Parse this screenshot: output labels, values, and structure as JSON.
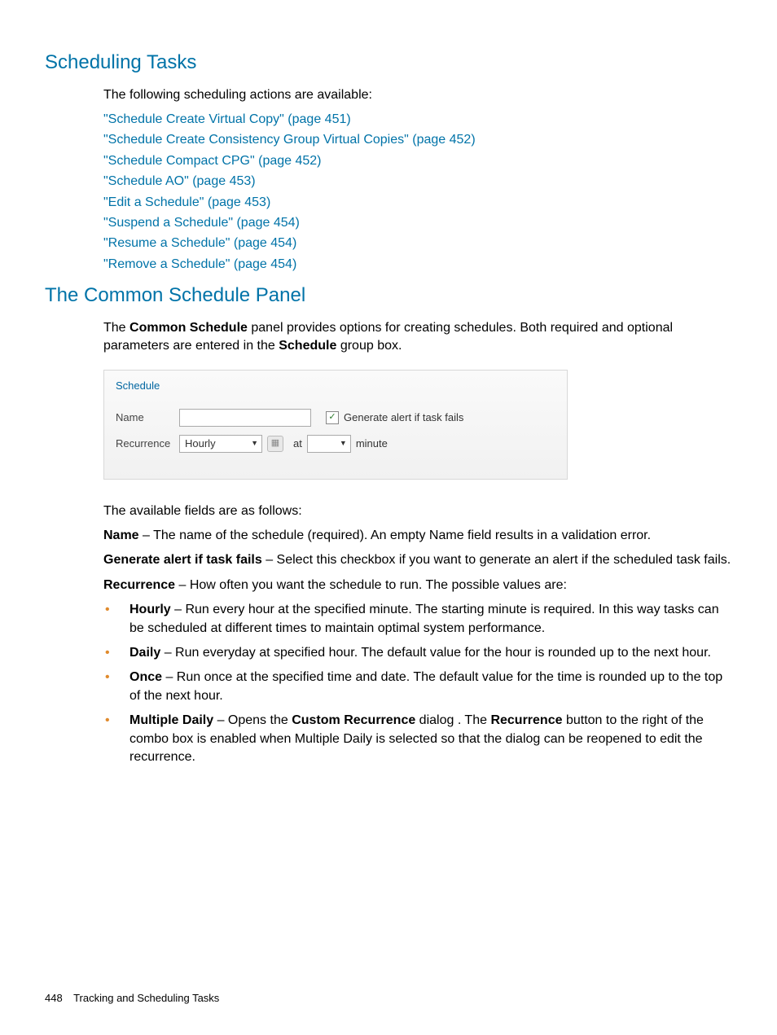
{
  "headings": {
    "h1": "Scheduling Tasks",
    "h2": "The Common Schedule Panel"
  },
  "intro1": "The following scheduling actions are available:",
  "links": [
    "\"Schedule Create Virtual Copy\" (page 451)",
    "\"Schedule Create Consistency Group Virtual Copies\" (page 452)",
    "\"Schedule Compact CPG\" (page 452)",
    "\"Schedule AO\" (page 453)",
    "\"Edit a Schedule\" (page 453)",
    "\"Suspend a Schedule\" (page 454)",
    "\"Resume a Schedule\" (page 454)",
    "\"Remove a Schedule\" (page 454)"
  ],
  "panel_intro": {
    "pre": "The ",
    "b1": "Common Schedule",
    "mid": " panel provides options for creating schedules. Both required and optional parameters are entered in the ",
    "b2": "Schedule",
    "post": " group box."
  },
  "panel": {
    "group_title": "Schedule",
    "name_label": "Name",
    "checkbox_label": "Generate alert if task fails",
    "recurrence_label": "Recurrence",
    "recurrence_value": "Hourly",
    "at_label": "at",
    "minute_label": "minute"
  },
  "fields_intro": "The available fields are as follows:",
  "field_name": {
    "b": "Name",
    "rest": " – The name of the schedule (required). An empty Name field results in a validation error."
  },
  "field_alert": {
    "b": "Generate alert if task fails",
    "rest": " – Select this checkbox if you want to generate an alert if the scheduled task fails."
  },
  "field_rec": {
    "b": "Recurrence",
    "rest": " – How often you want the schedule to run. The possible values are:"
  },
  "bullets": {
    "hourly": {
      "b": "Hourly",
      "rest": " – Run every hour at the specified minute. The starting minute is required. In this way tasks can be scheduled at different times to maintain optimal system performance."
    },
    "daily": {
      "b": "Daily",
      "rest": " – Run everyday at specified hour. The default value for the hour is rounded up to the next hour."
    },
    "once": {
      "b": "Once",
      "rest": " – Run once at the specified time and date. The default value for the time is rounded up to the top of the next hour."
    },
    "multi": {
      "b1": "Multiple Daily",
      "t1": " – Opens the ",
      "b2": "Custom Recurrence",
      "t2": " dialog . The ",
      "b3": "Recurrence",
      "t3": " button to the right of the combo box is enabled when Multiple Daily is selected so that the dialog can be reopened to edit the recurrence."
    }
  },
  "footer": {
    "page": "448",
    "title": "Tracking and Scheduling Tasks"
  }
}
